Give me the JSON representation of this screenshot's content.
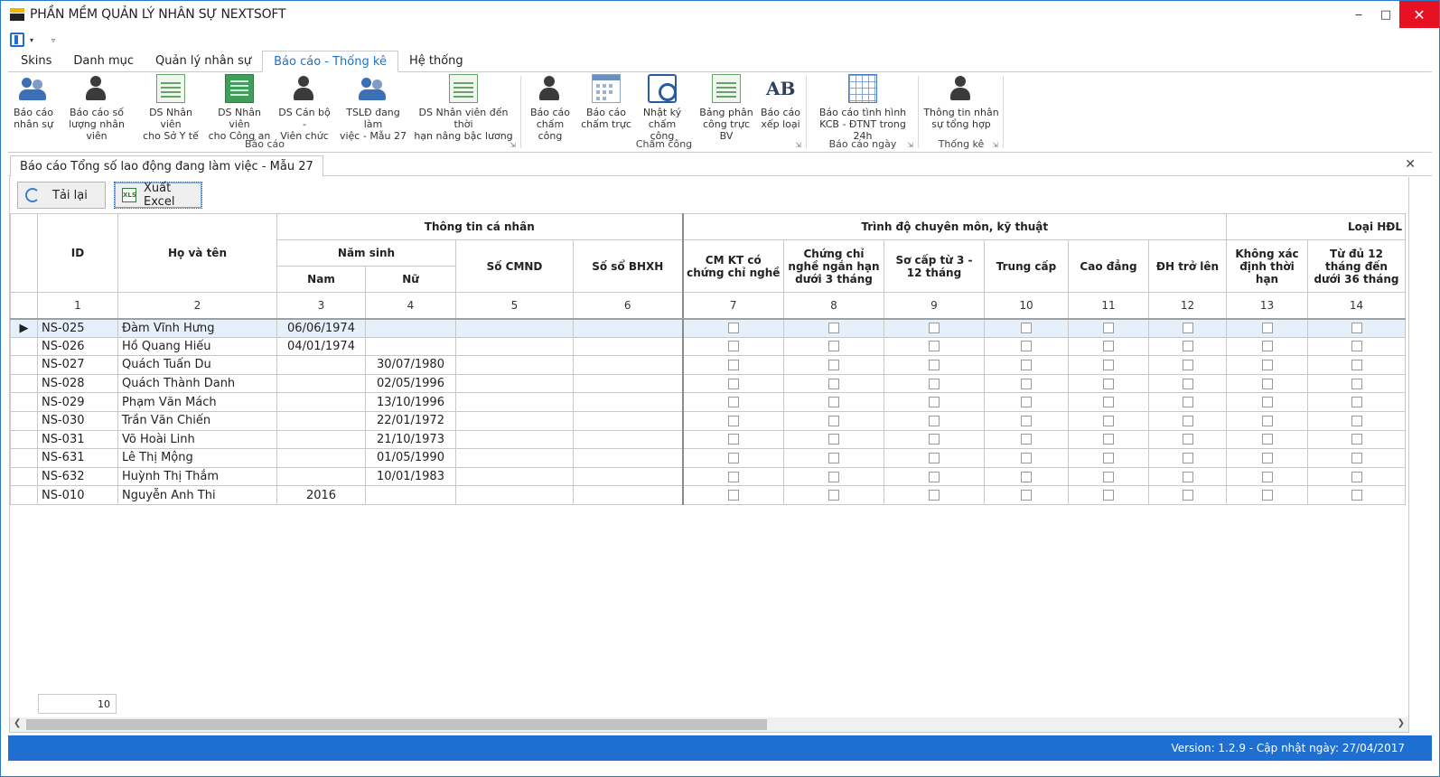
{
  "window": {
    "title": "PHẦN MỀM QUẢN LÝ NHÂN SỰ NEXTSOFT"
  },
  "ribbon_tabs": [
    {
      "label": "Skins"
    },
    {
      "label": "Danh mục"
    },
    {
      "label": "Quản lý nhân sự"
    },
    {
      "label": "Báo cáo - Thống kê",
      "active": true
    },
    {
      "label": "Hệ thống"
    }
  ],
  "ribbon": {
    "groups": [
      {
        "label": "Báo cáo",
        "buttons": [
          {
            "l1": "Báo cáo",
            "l2": "nhân sự",
            "icon": "users-report-icon"
          },
          {
            "l1": "Báo cáo số",
            "l2": "lượng nhân viên",
            "icon": "staff-count-icon"
          },
          {
            "l1": "DS Nhân viên",
            "l2": "cho Sở Y tế",
            "icon": "document-list-icon"
          },
          {
            "l1": "DS Nhân viên",
            "l2": "cho Công an",
            "icon": "spreadsheet-icon"
          },
          {
            "l1": "DS Cán bộ -",
            "l2": "Viên chức",
            "icon": "officials-icon"
          },
          {
            "l1": "TSLĐ đang làm",
            "l2": "việc - Mẫu 27",
            "icon": "workers-check-icon"
          },
          {
            "l1": "DS Nhân viên đến thời",
            "l2": "hạn nâng bậc lương",
            "icon": "profile-card-icon"
          }
        ]
      },
      {
        "label": "Chấm công",
        "buttons": [
          {
            "l1": "Báo cáo",
            "l2": "chấm công",
            "icon": "timesheet-user-icon"
          },
          {
            "l1": "Báo cáo",
            "l2": "chấm trực",
            "icon": "calendar-icon"
          },
          {
            "l1": "Nhật ký",
            "l2": "chấm công",
            "icon": "magnifier-doc-icon"
          },
          {
            "l1": "Bảng phân",
            "l2": "công trực BV",
            "icon": "duty-table-icon"
          },
          {
            "l1": "Báo cáo",
            "l2": "xếp loại",
            "icon": "ab-grade-icon"
          }
        ]
      },
      {
        "label": "Báo cáo ngày",
        "buttons": [
          {
            "l1": "Báo cáo tình hình",
            "l2": "KCB - ĐTNT trong 24h",
            "icon": "grid-table-icon"
          }
        ]
      },
      {
        "label": "Thống kê",
        "buttons": [
          {
            "l1": "Thông tin nhân",
            "l2": "sự tổng hợp",
            "icon": "hr-summary-icon"
          }
        ]
      }
    ]
  },
  "document_tab": {
    "title": "Báo cáo Tổng số lao động đang làm việc - Mẫu 27"
  },
  "toolbar": {
    "reload_label": "Tải lại",
    "export_label": "Xuất Excel"
  },
  "grid": {
    "group_headers": {
      "personal": "Thông tin cá nhân",
      "qualification": "Trình độ chuyên môn, kỹ thuật",
      "contract": "Loại HĐL"
    },
    "headers": {
      "id": "ID",
      "name": "Họ và tên",
      "birth_year": "Năm sinh",
      "male": "Nam",
      "female": "Nữ",
      "cmnd": "Số CMND",
      "bhxh": "Số sổ BHXH",
      "c7": "CM KT có chứng chỉ nghề",
      "c8": "Chứng chỉ nghề ngắn hạn dưới 3 tháng",
      "c9": "Sơ cấp từ 3 - 12 tháng",
      "c10": "Trung cấp",
      "c11": "Cao đẳng",
      "c12": "ĐH trở lên",
      "c13": "Không xác định thời hạn",
      "c14": "Từ đủ 12 tháng đến dưới 36 tháng"
    },
    "column_numbers": [
      "1",
      "2",
      "3",
      "4",
      "5",
      "6",
      "7",
      "8",
      "9",
      "10",
      "11",
      "12",
      "13",
      "14"
    ],
    "rows": [
      {
        "id": "NS-025",
        "name": "Đàm Vĩnh Hưng",
        "male": "06/06/1974",
        "female": "",
        "selected": true
      },
      {
        "id": "NS-026",
        "name": "Hồ Quang Hiếu",
        "male": "04/01/1974",
        "female": ""
      },
      {
        "id": "NS-027",
        "name": "Quách Tuấn Du",
        "male": "",
        "female": "30/07/1980"
      },
      {
        "id": "NS-028",
        "name": "Quách Thành Danh",
        "male": "",
        "female": "02/05/1996"
      },
      {
        "id": "NS-029",
        "name": "Phạm Văn Mách",
        "male": "",
        "female": "13/10/1996"
      },
      {
        "id": "NS-030",
        "name": "Trần Văn Chiến",
        "male": "",
        "female": "22/01/1972"
      },
      {
        "id": "NS-031",
        "name": "Võ Hoài Linh",
        "male": "",
        "female": "21/10/1973"
      },
      {
        "id": "NS-631",
        "name": "Lê Thị Mộng",
        "male": "",
        "female": "01/05/1990"
      },
      {
        "id": "NS-632",
        "name": "Huỳnh Thị Thắm",
        "male": "",
        "female": "10/01/1983"
      },
      {
        "id": "NS-010",
        "name": "Nguyễn Anh Thi",
        "male": "2016",
        "female": ""
      }
    ],
    "row_count": "10"
  },
  "status": {
    "version_text": "Version: 1.2.9 - Cập nhật ngày: 27/04/2017"
  },
  "colors": {
    "accent": "#1e6fd1",
    "close": "#e81123",
    "selected_row": "#e6f0fa"
  }
}
